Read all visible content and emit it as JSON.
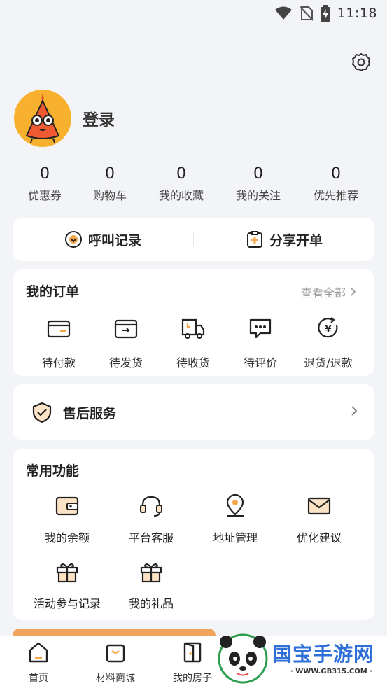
{
  "status_bar": {
    "time": "11:18",
    "icons": [
      "wifi-icon",
      "no-sim-icon",
      "battery-charging-icon"
    ]
  },
  "header": {
    "settings_icon": "gear-icon"
  },
  "profile": {
    "login_label": "登录",
    "avatar_icon": "mascot-avatar"
  },
  "stats": [
    {
      "value": "0",
      "label": "优惠券"
    },
    {
      "value": "0",
      "label": "购物车"
    },
    {
      "value": "0",
      "label": "我的收藏"
    },
    {
      "value": "0",
      "label": "我的关注"
    },
    {
      "value": "0",
      "label": "优先推荐"
    }
  ],
  "quick_actions": [
    {
      "label": "呼叫记录",
      "icon": "call-record-icon"
    },
    {
      "label": "分享开单",
      "icon": "share-order-icon"
    }
  ],
  "orders": {
    "title": "我的订单",
    "view_all": "查看全部",
    "items": [
      {
        "label": "待付款",
        "icon": "wallet-icon"
      },
      {
        "label": "待发货",
        "icon": "shipping-box-icon"
      },
      {
        "label": "待收货",
        "icon": "delivery-truck-icon"
      },
      {
        "label": "待评价",
        "icon": "comment-icon"
      },
      {
        "label": "退货/退款",
        "icon": "refund-icon"
      }
    ]
  },
  "after_sale": {
    "label": "售后服务",
    "icon": "shield-check-icon"
  },
  "common_functions": {
    "title": "常用功能",
    "items": [
      {
        "label": "我的余额",
        "icon": "balance-wallet-icon"
      },
      {
        "label": "平台客服",
        "icon": "headset-icon"
      },
      {
        "label": "地址管理",
        "icon": "location-pin-icon"
      },
      {
        "label": "优化建议",
        "icon": "mail-icon"
      },
      {
        "label": "活动参与记录",
        "icon": "gift-icon"
      },
      {
        "label": "我的礼品",
        "icon": "gift-icon"
      }
    ]
  },
  "tabbar": [
    {
      "label": "首页",
      "icon": "home-icon"
    },
    {
      "label": "材料商城",
      "icon": "shopping-bag-icon"
    },
    {
      "label": "我的房子",
      "icon": "door-icon"
    }
  ],
  "watermark": {
    "text": "国宝手游网",
    "url": "· WWW.GB315.COM ·"
  },
  "colors": {
    "accent": "#f7a64a",
    "background": "#f3f4f7",
    "card": "#ffffff"
  }
}
